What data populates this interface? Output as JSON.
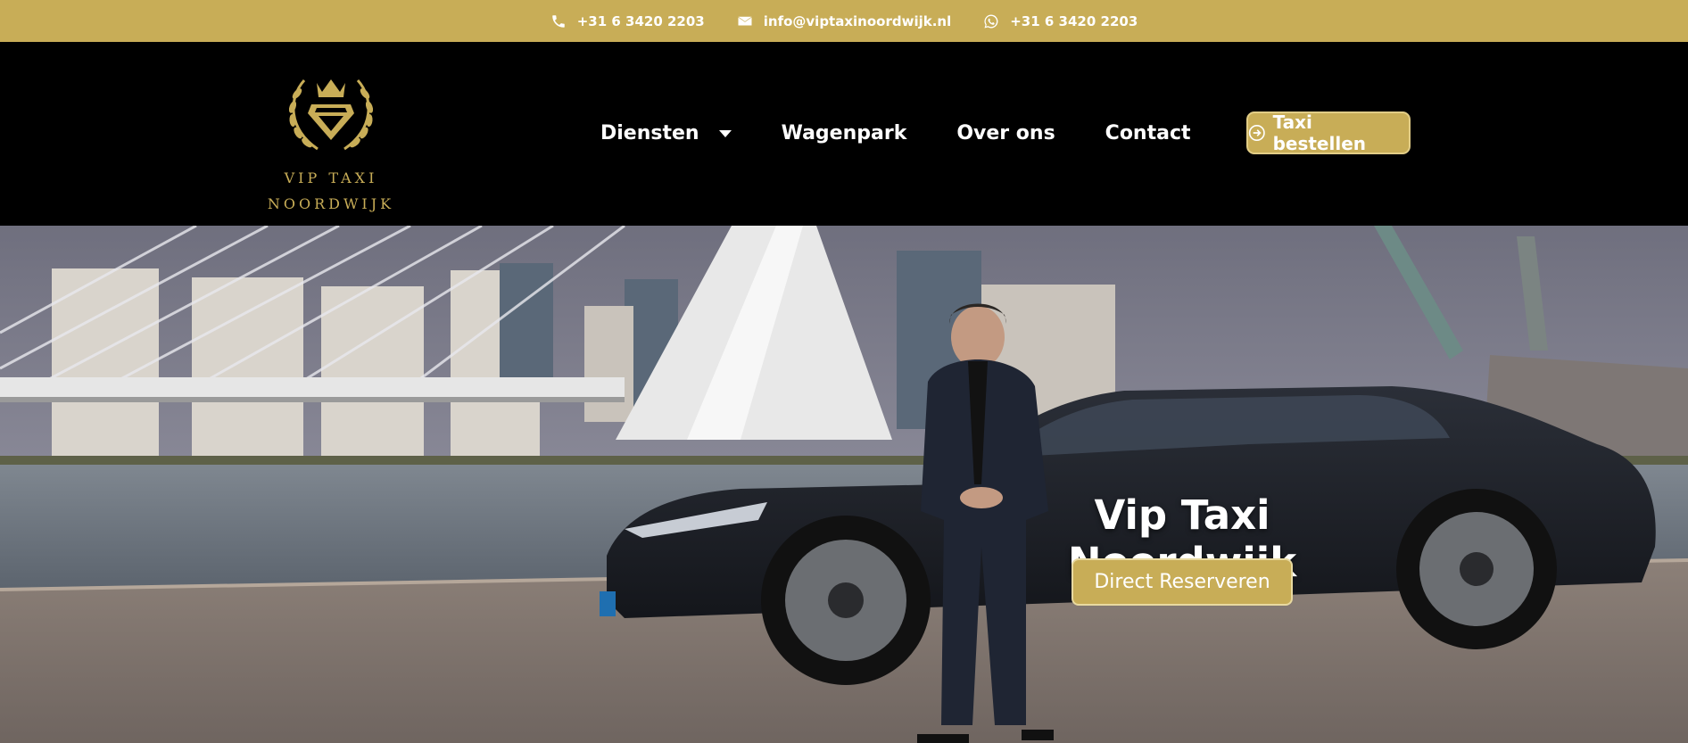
{
  "topbar": {
    "phone": "+31 6 3420 2203",
    "email": "info@viptaxinoordwijk.nl",
    "whatsapp": "+31 6 3420 2203",
    "icons": [
      "phone-icon",
      "envelope-icon",
      "whatsapp-icon"
    ]
  },
  "logo": {
    "line1": "VIP TAXI",
    "line2": "NOORDWIJK"
  },
  "nav": {
    "items": [
      {
        "label": "Diensten",
        "has_dropdown": true
      },
      {
        "label": "Wagenpark"
      },
      {
        "label": "Over ons"
      },
      {
        "label": "Contact"
      }
    ]
  },
  "cta": {
    "label": "Taxi bestellen",
    "icon": "arrow-circle-right-icon"
  },
  "hero": {
    "title": "Vip Taxi Noordwijk",
    "button_label": "Direct Reserveren"
  },
  "colors": {
    "accent": "#c8ad57",
    "header_bg": "#000000",
    "text": "#ffffff"
  }
}
